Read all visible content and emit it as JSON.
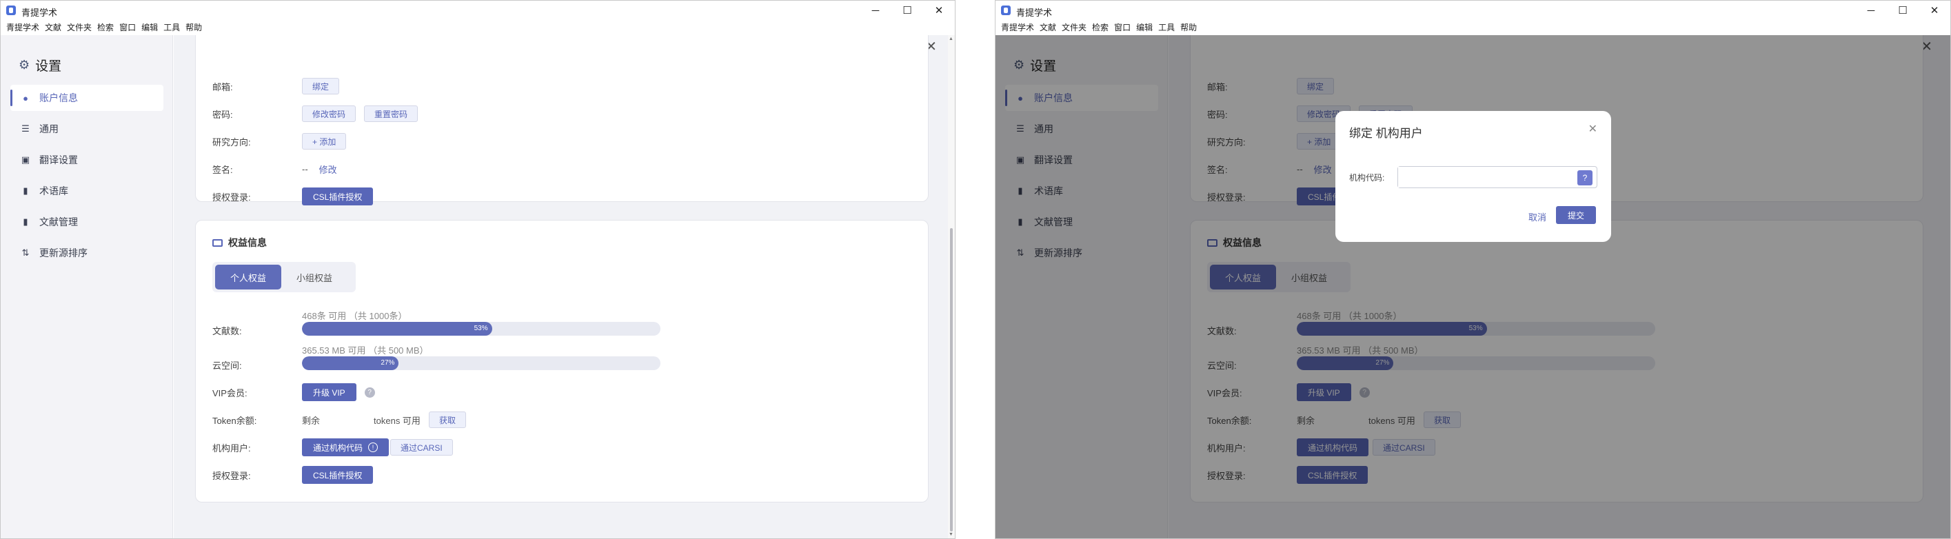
{
  "app": {
    "title": "青提学术"
  },
  "menu": [
    "青提学术",
    "文献",
    "文件夹",
    "检索",
    "窗口",
    "编辑",
    "工具",
    "帮助"
  ],
  "sidebar": {
    "title": "设置",
    "items": [
      {
        "label": "账户信息",
        "icon": "user-icon"
      },
      {
        "label": "通用",
        "icon": "sliders-icon"
      },
      {
        "label": "翻译设置",
        "icon": "translate-icon"
      },
      {
        "label": "术语库",
        "icon": "book-icon"
      },
      {
        "label": "文献管理",
        "icon": "book-icon"
      },
      {
        "label": "更新源排序",
        "icon": "sort-icon"
      }
    ]
  },
  "account": {
    "email": {
      "label": "邮箱:",
      "button": "绑定"
    },
    "password": {
      "label": "密码:",
      "change": "修改密码",
      "reset": "重置密码"
    },
    "research": {
      "label": "研究方向:",
      "button": "+ 添加"
    },
    "signature": {
      "label": "签名:",
      "value": "--",
      "link": "修改"
    },
    "csl": {
      "label": "授权登录:",
      "button": "CSL插件授权"
    }
  },
  "benefits": {
    "title": "权益信息",
    "tabs": [
      "个人权益",
      "小组权益"
    ],
    "docs": {
      "label": "文献数:",
      "text": "468条 可用 （共 1000条）",
      "percent": 53,
      "percent_label": "53%"
    },
    "cloud": {
      "label": "云空间:",
      "text": "365.53 MB 可用 （共 500 MB）",
      "percent": 27,
      "percent_label": "27%"
    },
    "vip": {
      "label": "VIP会员:",
      "button": "升级 VIP",
      "help": "?"
    },
    "token": {
      "label": "Token余额:",
      "remaining": "剩余",
      "available": "tokens 可用",
      "button": "获取"
    },
    "institution": {
      "label": "机构用户:",
      "by_code": "通过机构代码",
      "by_carsi": "通过CARSI",
      "info": "!"
    },
    "csl": {
      "label": "授权登录:",
      "button": "CSL插件授权"
    }
  },
  "dialog": {
    "title": "绑定 机构用户",
    "field_label": "机构代码:",
    "placeholder": "",
    "help": "?",
    "cancel": "取消",
    "submit": "提交"
  },
  "colors": {
    "accent": "#5866b8"
  }
}
